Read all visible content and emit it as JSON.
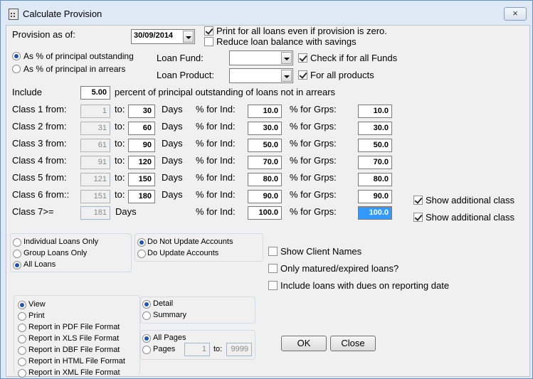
{
  "window": {
    "title": "Calculate Provision",
    "close_icon": "×"
  },
  "provision": {
    "label": "Provision as of:",
    "date": "30/09/2014",
    "print_all_label": "Print for all loans even if provision is zero.",
    "reduce_savings_label": "Reduce loan balance with savings"
  },
  "basis": {
    "outstanding_label": "As % of principal outstanding",
    "arrears_label": "As % of principal in arrears"
  },
  "fund": {
    "label": "Loan Fund:",
    "value": "",
    "all_label": "Check if for all Funds"
  },
  "product": {
    "label": "Loan Product:",
    "value": "",
    "all_label": "For all products"
  },
  "include": {
    "label": "Include",
    "value": "5.00",
    "suffix": "percent of principal outstanding of loans not in arrears"
  },
  "classes": {
    "to_label": "to:",
    "days_label": "Days",
    "ind_label": "% for Ind:",
    "grp_label": "% for Grps:",
    "rows": [
      {
        "label": "Class 1 from:",
        "from": "1",
        "to": "30",
        "ind": "10.0",
        "grp": "10.0"
      },
      {
        "label": "Class 2 from:",
        "from": "31",
        "to": "60",
        "ind": "30.0",
        "grp": "30.0"
      },
      {
        "label": "Class 3 from:",
        "from": "61",
        "to": "90",
        "ind": "50.0",
        "grp": "50.0"
      },
      {
        "label": "Class 4 from:",
        "from": "91",
        "to": "120",
        "ind": "70.0",
        "grp": "70.0"
      },
      {
        "label": "Class 5 from:",
        "from": "121",
        "to": "150",
        "ind": "80.0",
        "grp": "80.0"
      },
      {
        "label": "Class 6 from::",
        "from": "151",
        "to": "180",
        "ind": "90.0",
        "grp": "90.0"
      }
    ],
    "last": {
      "label": "Class 7>=",
      "from": "181",
      "ind": "100.0",
      "grp": "100.0"
    },
    "show_additional_1": "Show additional class",
    "show_additional_2": "Show additional class"
  },
  "loan_type": {
    "individual": "Individual Loans Only",
    "group": "Group Loans Only",
    "all": "All Loans"
  },
  "accounts": {
    "no_update": "Do Not Update Accounts",
    "update": "Do Update Accounts"
  },
  "options": {
    "client_names": "Show Client Names",
    "matured": "Only matured/expired loans?",
    "dues": "Include loans with dues on reporting date"
  },
  "output": {
    "view": "View",
    "print": "Print",
    "pdf": "Report in PDF File Format",
    "xls": "Report in XLS File Format",
    "dbf": "Report in DBF File Format",
    "html": "Report in HTML File Format",
    "xml": "Report in XML File Format"
  },
  "detail_mode": {
    "detail": "Detail",
    "summary": "Summary"
  },
  "pages": {
    "all": "All Pages",
    "range": "Pages",
    "from": "1",
    "to_label": "to:",
    "to": "9999"
  },
  "buttons": {
    "ok": "OK",
    "close": "Close"
  }
}
